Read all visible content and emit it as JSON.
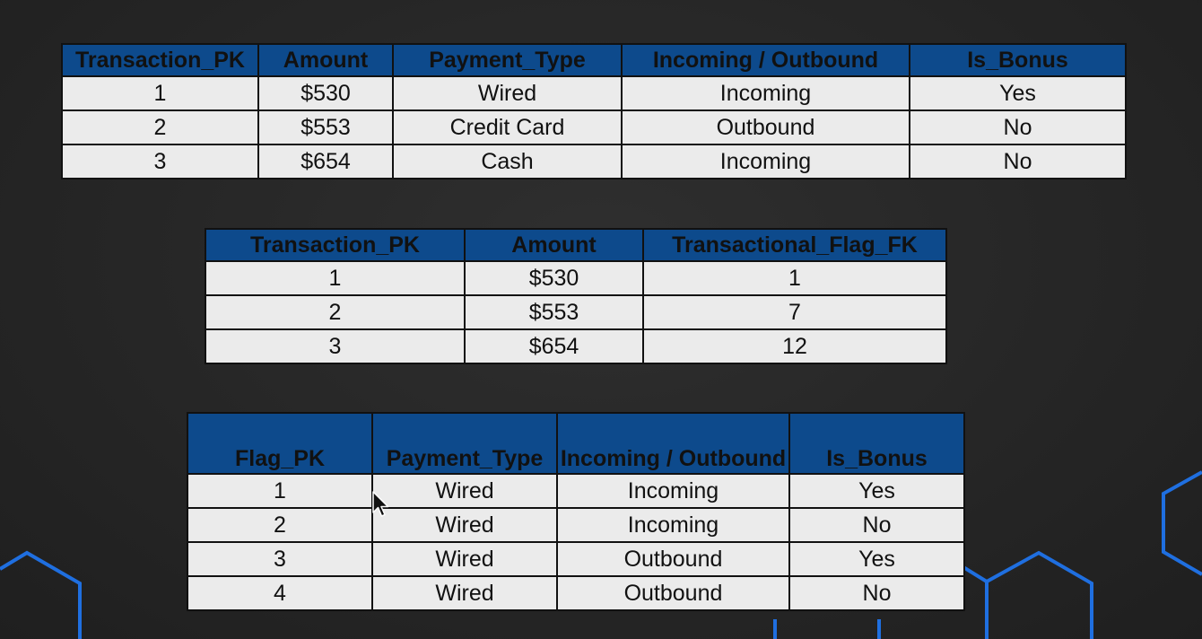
{
  "table1": {
    "headers": [
      "Transaction_PK",
      "Amount",
      "Payment_Type",
      "Incoming / Outbound",
      "Is_Bonus"
    ],
    "rows": [
      [
        "1",
        "$530",
        "Wired",
        "Incoming",
        "Yes"
      ],
      [
        "2",
        "$553",
        "Credit Card",
        "Outbound",
        "No"
      ],
      [
        "3",
        "$654",
        "Cash",
        "Incoming",
        "No"
      ]
    ]
  },
  "table2": {
    "headers": [
      "Transaction_PK",
      "Amount",
      "Transactional_Flag_FK"
    ],
    "rows": [
      [
        "1",
        "$530",
        "1"
      ],
      [
        "2",
        "$553",
        "7"
      ],
      [
        "3",
        "$654",
        "12"
      ]
    ]
  },
  "table3": {
    "headers": [
      "Flag_PK",
      "Payment_Type",
      "Incoming / Outbound",
      "Is_Bonus"
    ],
    "rows": [
      [
        "1",
        "Wired",
        "Incoming",
        "Yes"
      ],
      [
        "2",
        "Wired",
        "Incoming",
        "No"
      ],
      [
        "3",
        "Wired",
        "Outbound",
        "Yes"
      ],
      [
        "4",
        "Wired",
        "Outbound",
        "No"
      ]
    ]
  },
  "colors": {
    "header_bg": "#0d4a8c",
    "cell_bg": "#ebebeb",
    "background": "#262626",
    "hexagon_accent": "#1f6fe0"
  },
  "icons": [
    "mouse-cursor-icon",
    "hexagon-decoration-icon"
  ]
}
